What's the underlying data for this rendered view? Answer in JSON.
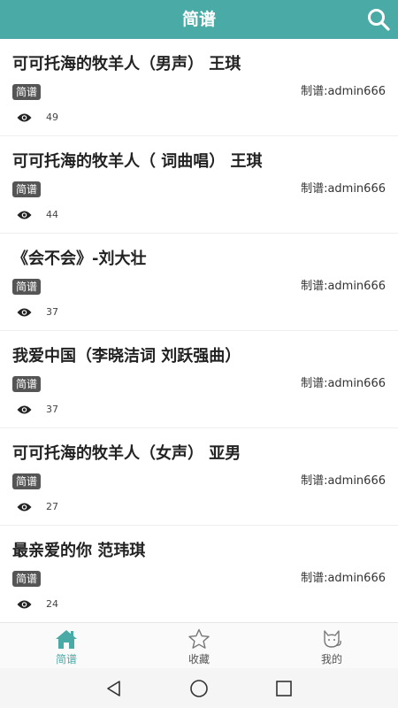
{
  "header": {
    "title": "简谱"
  },
  "colors": {
    "accent": "#4aaaa5",
    "tag_bg": "#555555"
  },
  "songs": [
    {
      "title": "可可托海的牧羊人（男声） 王琪",
      "tag": "简谱",
      "author": "制谱:admin666",
      "views": "49"
    },
    {
      "title": "可可托海的牧羊人（ 词曲唱） 王琪",
      "tag": "简谱",
      "author": "制谱:admin666",
      "views": "44"
    },
    {
      "title": "《会不会》-刘大壮",
      "tag": "简谱",
      "author": "制谱:admin666",
      "views": "37"
    },
    {
      "title": "我爱中国（李晓洁词 刘跃强曲）",
      "tag": "简谱",
      "author": "制谱:admin666",
      "views": "37"
    },
    {
      "title": "可可托海的牧羊人（女声） 亚男",
      "tag": "简谱",
      "author": "制谱:admin666",
      "views": "27"
    },
    {
      "title": "最亲爱的你 范玮琪",
      "tag": "简谱",
      "author": "制谱:admin666",
      "views": "24"
    }
  ],
  "tabs": [
    {
      "label": "简谱",
      "icon": "home-icon",
      "active": true
    },
    {
      "label": "收藏",
      "icon": "star-icon",
      "active": false
    },
    {
      "label": "我的",
      "icon": "cat-icon",
      "active": false
    }
  ],
  "system_nav": {
    "icons": [
      "back-icon",
      "home-circle-icon",
      "recents-icon"
    ]
  }
}
